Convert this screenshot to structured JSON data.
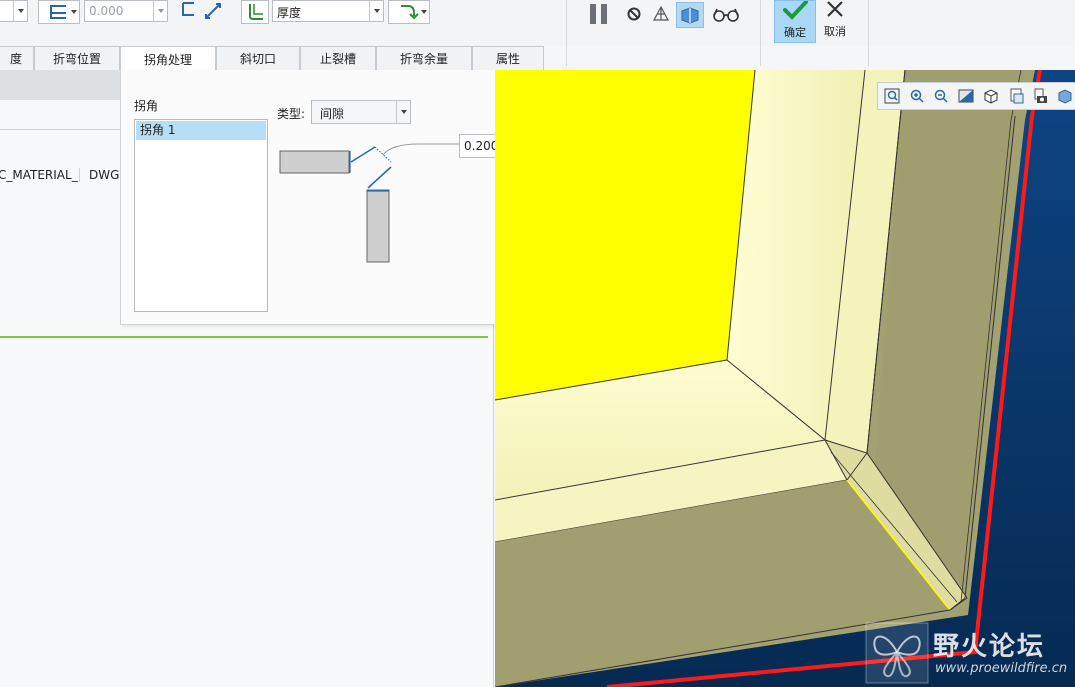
{
  "toolbar": {
    "value_field": "0.000",
    "thickness_field": "厚度",
    "confirm_label": "确定",
    "cancel_label": "取消"
  },
  "tabs": [
    {
      "label": "度"
    },
    {
      "label": "折弯位置"
    },
    {
      "label": "拐角处理"
    },
    {
      "label": "斜切口"
    },
    {
      "label": "止裂槽"
    },
    {
      "label": "折弯余量"
    },
    {
      "label": "属性"
    }
  ],
  "tree": {
    "col_material": "C_MATERIAL_",
    "col_dwg": "DWG"
  },
  "panel": {
    "corner_label": "拐角",
    "type_label": "类型:",
    "type_value": "间隙",
    "gap_value": "0.200",
    "corners": [
      {
        "label": "拐角 1"
      }
    ]
  },
  "watermark": {
    "title": "野火论坛",
    "url": "www.proewildfire.cn"
  },
  "colors": {
    "confirm_highlight": "#a9d7f5",
    "confirm_check": "#1e9a3c",
    "selected_item": "#b7ddf7",
    "viewport_bg": "#0c3f7a",
    "model_light": "#fdfdc3",
    "model_dark": "#a09e6e",
    "highlight_yellow": "#ffff00",
    "edge_red": "#ff1a1a"
  }
}
